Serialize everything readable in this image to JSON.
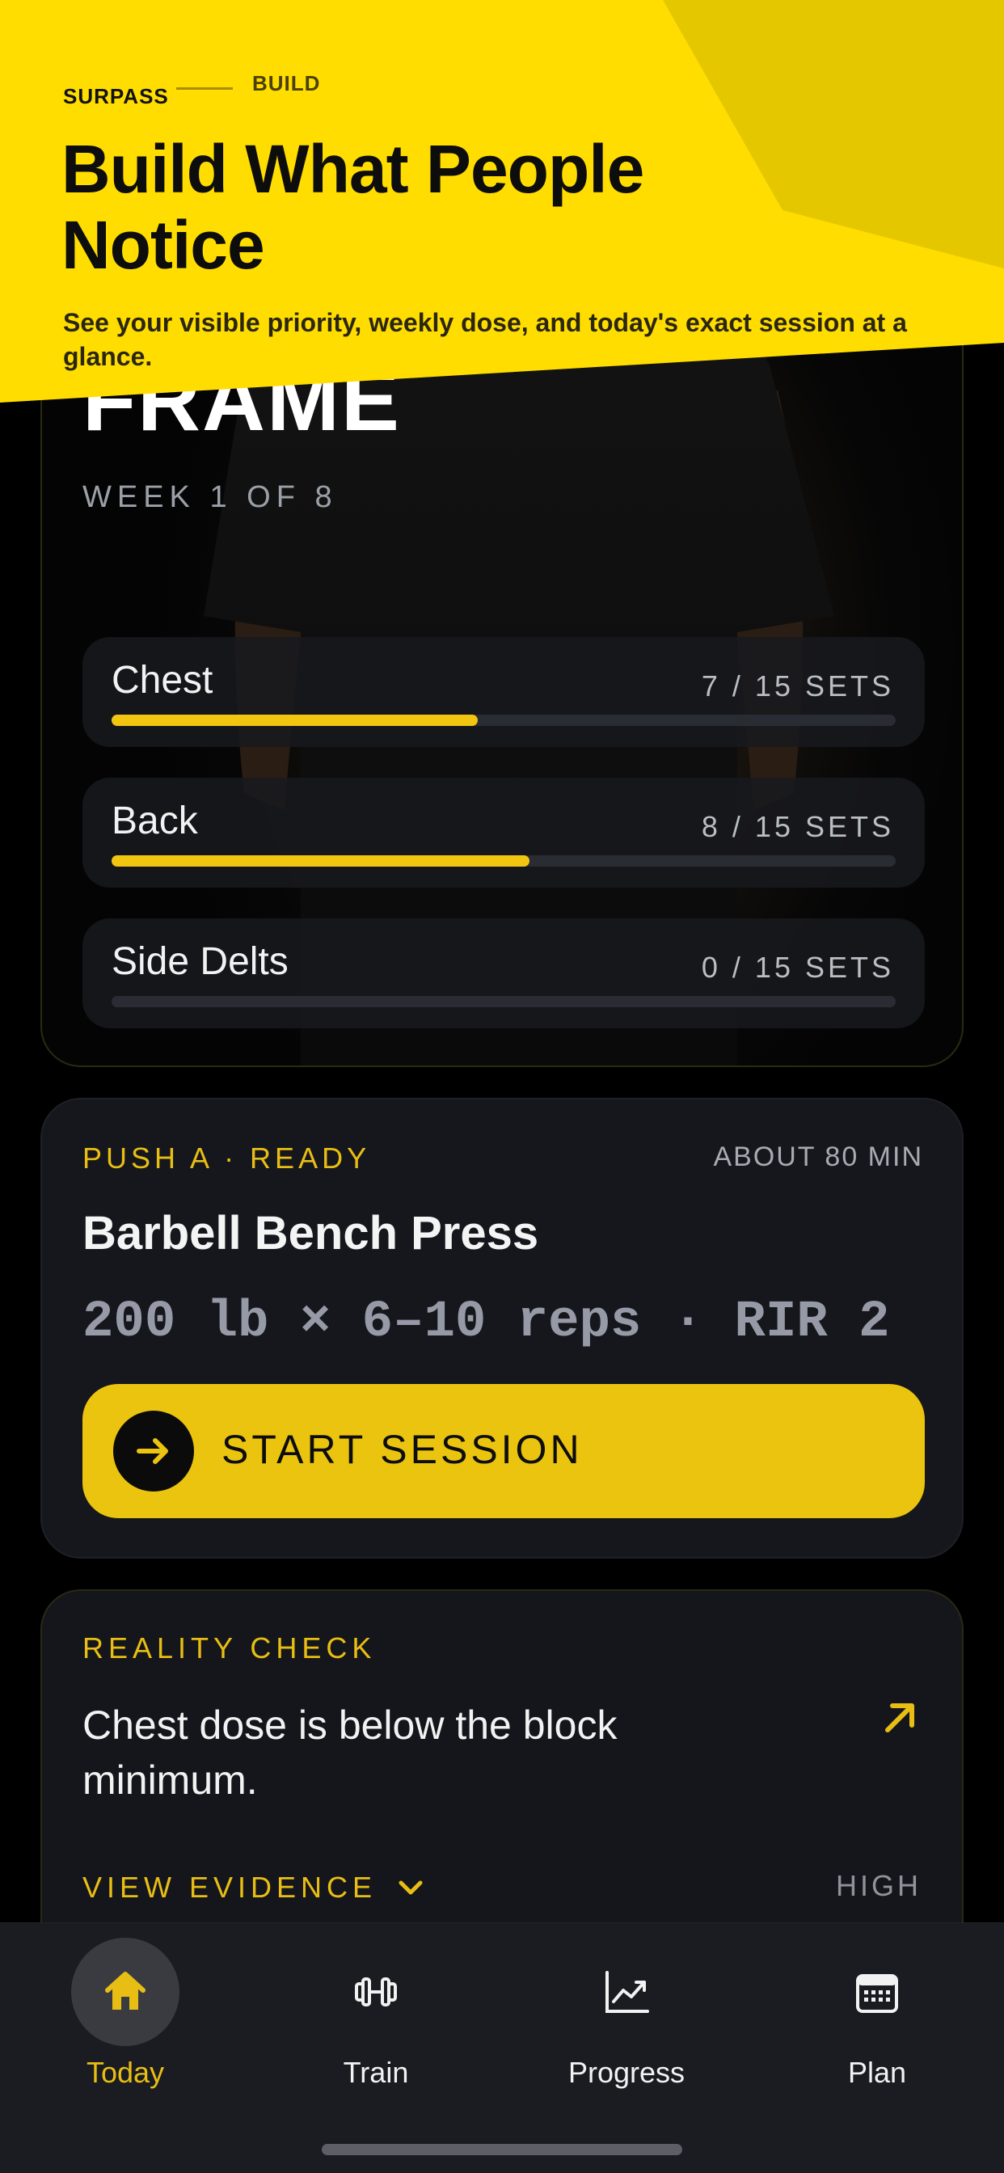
{
  "banner": {
    "brand": "SURPASS",
    "step": "BUILD",
    "title": "Build What People Notice",
    "subtitle": "See your visible priority, weekly dose, and today's exact session at a glance."
  },
  "hero": {
    "title": "FRAME",
    "week": "WEEK 1 OF 8",
    "volume": [
      {
        "muscle": "Chest",
        "count": "7 / 15 SETS",
        "done": 7,
        "target": 15
      },
      {
        "muscle": "Back",
        "count": "8 / 15 SETS",
        "done": 8,
        "target": 15
      },
      {
        "muscle": "Side Delts",
        "count": "0 / 15 SETS",
        "done": 0,
        "target": 15
      }
    ]
  },
  "session": {
    "status": "PUSH A · READY",
    "duration": "ABOUT 80 MIN",
    "exercise": "Barbell Bench Press",
    "target": "200 lb × 6–10 reps · RIR 2",
    "start_label": "START SESSION"
  },
  "reality": {
    "heading": "REALITY CHECK",
    "message": "Chest dose is below the block minimum.",
    "evidence_label": "VIEW EVIDENCE",
    "severity": "HIGH"
  },
  "tabs": [
    {
      "label": "Today",
      "icon": "home-icon",
      "active": true
    },
    {
      "label": "Train",
      "icon": "dumbbell-icon",
      "active": false
    },
    {
      "label": "Progress",
      "icon": "chart-icon",
      "active": false
    },
    {
      "label": "Plan",
      "icon": "calendar-icon",
      "active": false
    }
  ],
  "colors": {
    "accent": "#EBC40F",
    "banner": "#FFDD00",
    "background": "#000000",
    "card": "#16171C"
  }
}
